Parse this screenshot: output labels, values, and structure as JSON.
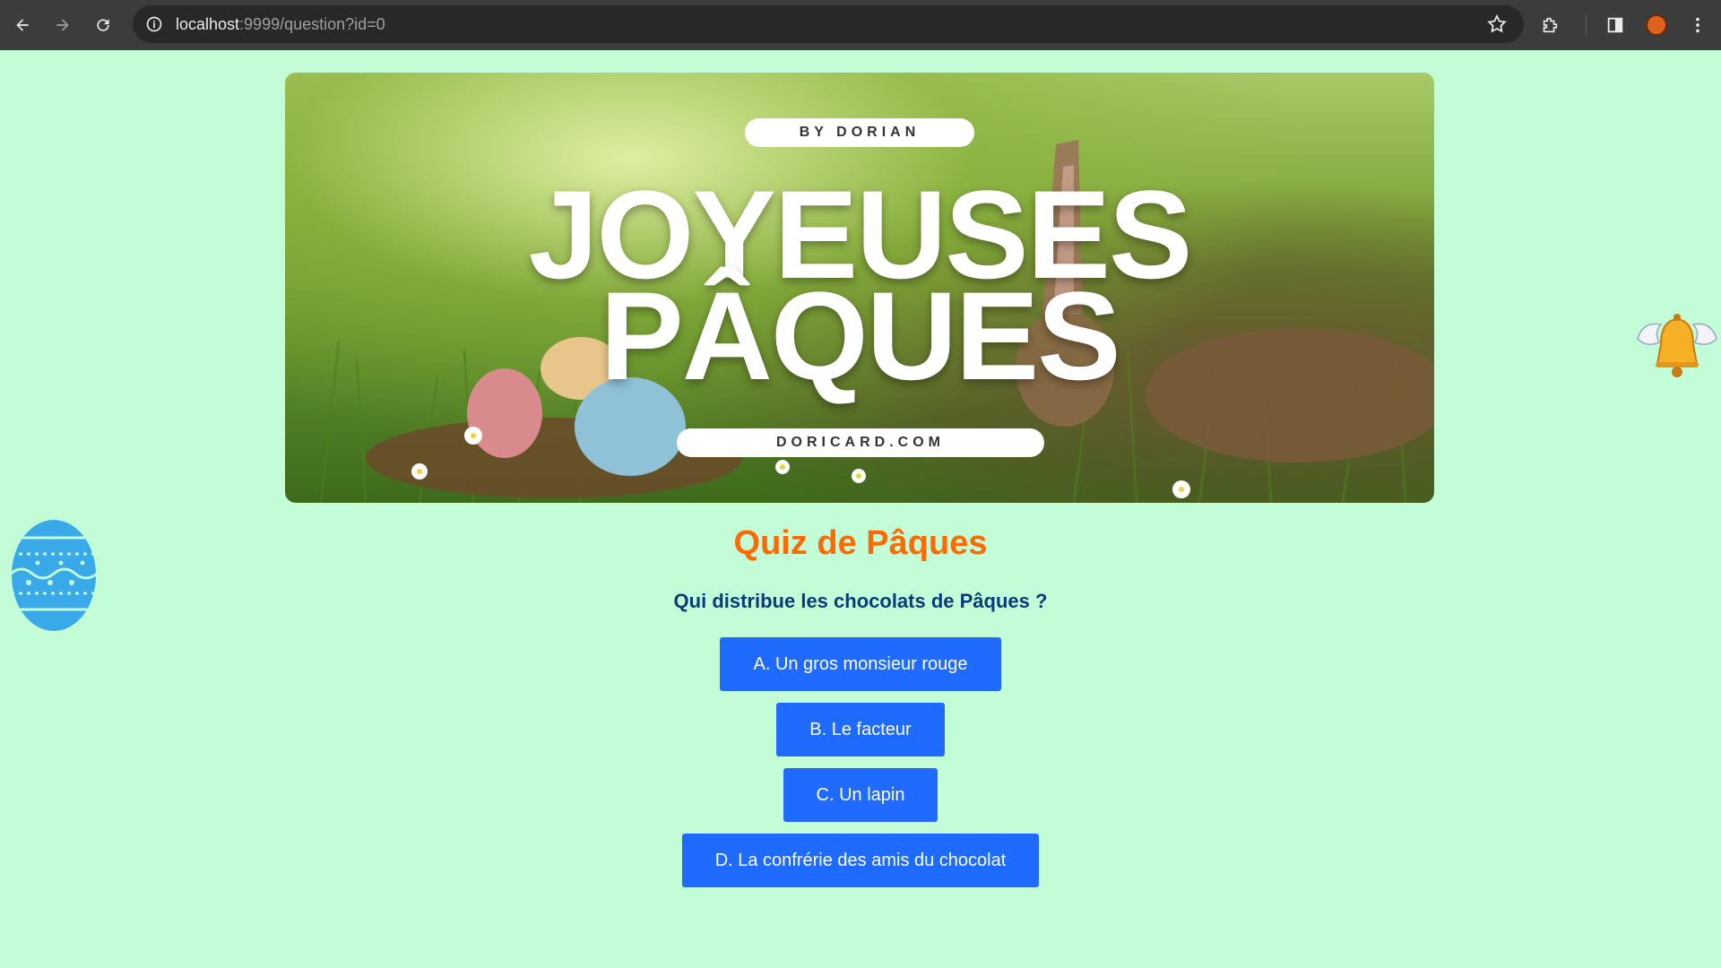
{
  "browser": {
    "url_host": "localhost",
    "url_rest": ":9999/question?id=0",
    "icons": [
      "back-icon",
      "forward-icon",
      "reload-icon",
      "info-icon",
      "star-icon",
      "extensions-icon",
      "side-panel-icon",
      "profile-avatar",
      "menu-icon"
    ]
  },
  "banner": {
    "top_pill": "BY DORIAN",
    "line1": "JOYEUSES",
    "line2": "PÂQUES",
    "bottom_pill": "DORICARD.COM"
  },
  "quiz": {
    "title": "Quiz de Pâques",
    "question": "Qui distribue les chocolats de Pâques ?",
    "answers": [
      "A. Un gros monsieur rouge",
      "B. Le facteur",
      "C. Un lapin",
      "D. La confrérie des amis du chocolat"
    ]
  },
  "colors": {
    "page_bg": "#c3fdd8",
    "title": "#ff6a00",
    "question": "#0b3a7a",
    "button": "#1f6bff"
  },
  "decorations": [
    "easter-egg-icon",
    "winged-bell-icon"
  ]
}
